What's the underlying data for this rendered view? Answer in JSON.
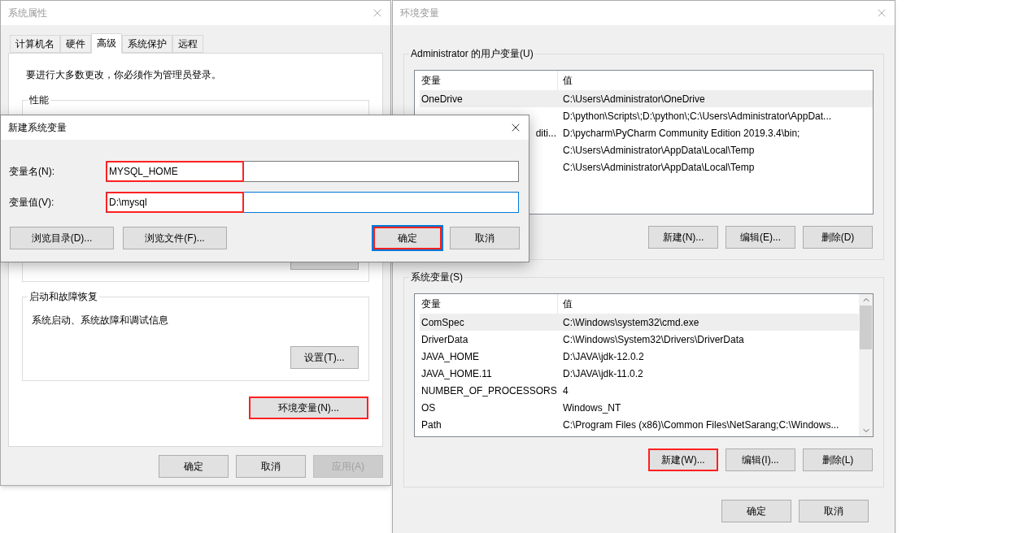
{
  "system_properties": {
    "title": "系统属性",
    "tabs": [
      {
        "label": "计算机名",
        "selected": false
      },
      {
        "label": "硬件",
        "selected": false
      },
      {
        "label": "高级",
        "selected": true
      },
      {
        "label": "系统保护",
        "selected": false
      },
      {
        "label": "远程",
        "selected": false
      }
    ],
    "notice": "要进行大多数更改，你必须作为管理员登录。",
    "performance_group": {
      "title": "性能"
    },
    "startup_group": {
      "title": "启动和故障恢复",
      "text": "系统启动、系统故障和调试信息",
      "button": {
        "label": "设置(T)...",
        "highlighted": false
      }
    },
    "env_button": {
      "label": "环境变量(N)...",
      "highlighted": true
    },
    "buttons": [
      {
        "label": "确定",
        "disabled": false
      },
      {
        "label": "取消",
        "disabled": false
      },
      {
        "label": "应用(A)",
        "disabled": true
      }
    ]
  },
  "environment_variables": {
    "title": "环境变量",
    "user_vars": {
      "title": "Administrator 的用户变量(U)",
      "columns": [
        "变量",
        "值"
      ],
      "rows": [
        {
          "name": "OneDrive",
          "value": "C:\\Users\\Administrator\\OneDrive",
          "selected": true
        },
        {
          "value": "D:\\python\\Scripts\\;D:\\python\\;C:\\Users\\Administrator\\AppDat...",
          "selected": false
        },
        {
          "name": "diti...",
          "name_cut_left": true,
          "value": "D:\\pycharm\\PyCharm Community Edition 2019.3.4\\bin;",
          "selected": false
        },
        {
          "value": "C:\\Users\\Administrator\\AppData\\Local\\Temp",
          "selected": false
        },
        {
          "value": "C:\\Users\\Administrator\\AppData\\Local\\Temp",
          "selected": false
        }
      ],
      "buttons": [
        {
          "label": "新建(N)...",
          "highlighted": false
        },
        {
          "label": "编辑(E)...",
          "highlighted": false
        },
        {
          "label": "删除(D)",
          "highlighted": false
        }
      ]
    },
    "system_vars": {
      "title": "系统变量(S)",
      "columns": [
        "变量",
        "值"
      ],
      "scrollbar": true,
      "rows": [
        {
          "name": "ComSpec",
          "value": "C:\\Windows\\system32\\cmd.exe",
          "selected": true
        },
        {
          "name": "DriverData",
          "value": "C:\\Windows\\System32\\Drivers\\DriverData",
          "selected": false
        },
        {
          "name": "JAVA_HOME",
          "value": "D:\\JAVA\\jdk-12.0.2",
          "selected": false
        },
        {
          "name": "JAVA_HOME.11",
          "value": "D:\\JAVA\\jdk-11.0.2",
          "selected": false
        },
        {
          "name": "NUMBER_OF_PROCESSORS",
          "value": "4",
          "selected": false
        },
        {
          "name": "OS",
          "value": "Windows_NT",
          "selected": false
        },
        {
          "name": "Path",
          "value": "C:\\Program Files (x86)\\Common Files\\NetSarang;C:\\Windows...",
          "selected": false
        }
      ],
      "buttons": [
        {
          "label": "新建(W)...",
          "highlighted": true
        },
        {
          "label": "编辑(I)...",
          "highlighted": false
        },
        {
          "label": "删除(L)",
          "highlighted": false
        }
      ]
    },
    "buttons": [
      {
        "label": "确定"
      },
      {
        "label": "取消"
      }
    ]
  },
  "new_variable_dialog": {
    "title": "新建系统变量",
    "fields": [
      {
        "label": "变量名(N):",
        "value": "MYSQL_HOME",
        "focused": false,
        "highlighted": true
      },
      {
        "label": "变量值(V):",
        "value": "D:\\mysql",
        "focused": true,
        "highlighted": true
      }
    ],
    "browse_buttons": [
      {
        "label": "浏览目录(D)...",
        "default": false,
        "highlighted": false
      },
      {
        "label": "浏览文件(F)...",
        "default": false,
        "highlighted": false
      }
    ],
    "buttons": [
      {
        "label": "确定",
        "default": true,
        "highlighted": true
      },
      {
        "label": "取消",
        "default": false,
        "highlighted": false
      }
    ]
  }
}
